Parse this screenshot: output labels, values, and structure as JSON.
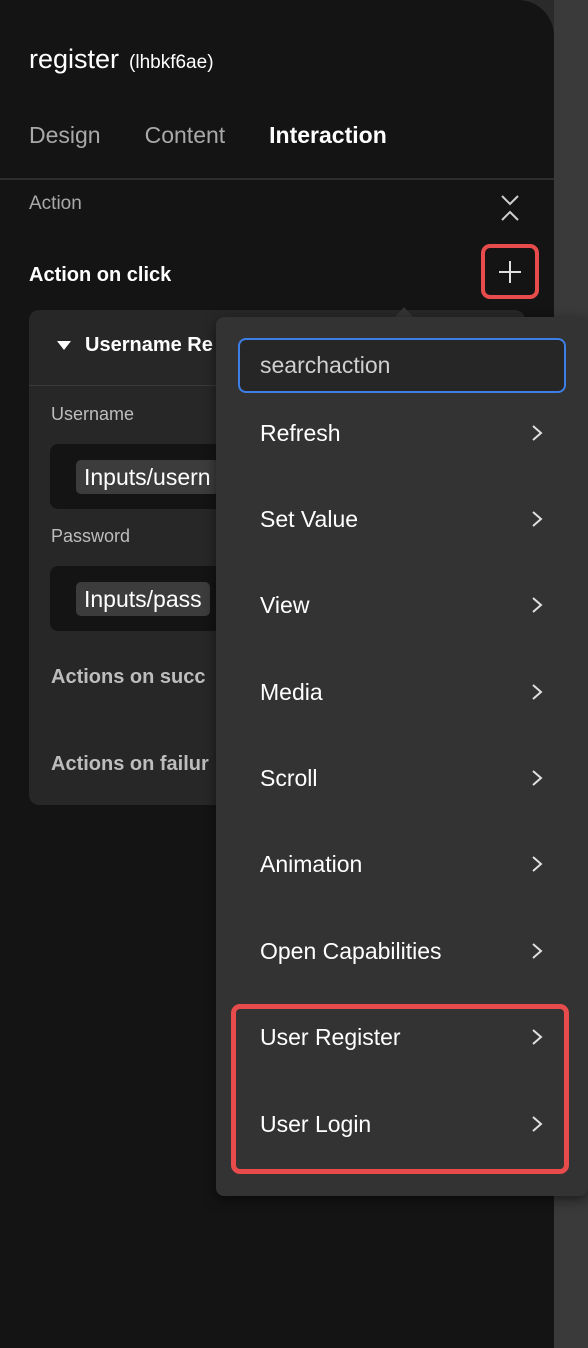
{
  "header": {
    "title": "register",
    "id": "(lhbkf6ae)"
  },
  "tabs": [
    {
      "label": "Design"
    },
    {
      "label": "Content"
    },
    {
      "label": "Interaction",
      "active": true
    }
  ],
  "section": {
    "label": "Action"
  },
  "action_on_click": {
    "label": "Action on click"
  },
  "card": {
    "title": "Username Re",
    "fields": [
      {
        "label": "Username",
        "value": "Inputs/usern"
      },
      {
        "label": "Password",
        "value": "Inputs/pass"
      }
    ],
    "on_success_label": "Actions on succ",
    "on_failure_label": "Actions on failur"
  },
  "dropdown": {
    "search_placeholder": "searchaction",
    "items": [
      {
        "label": "Refresh"
      },
      {
        "label": "Set Value"
      },
      {
        "label": "View"
      },
      {
        "label": "Media"
      },
      {
        "label": "Scroll"
      },
      {
        "label": "Animation"
      },
      {
        "label": "Open Capabilities"
      },
      {
        "label": "User Register"
      },
      {
        "label": "User Login"
      }
    ]
  },
  "colors": {
    "highlight": "#e84b4b",
    "focus": "#3d7fe6",
    "panel": "#141414",
    "dropdown": "#333333"
  }
}
